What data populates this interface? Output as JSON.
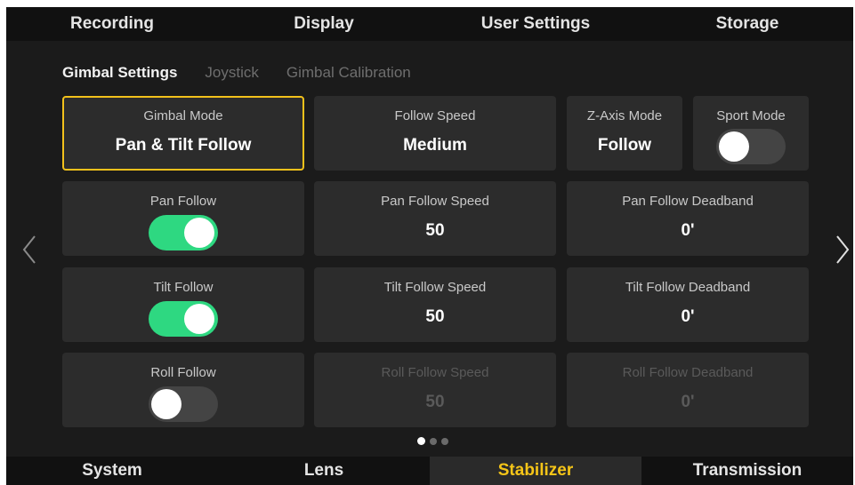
{
  "top_tabs": [
    "Recording",
    "Display",
    "User Settings",
    "Storage"
  ],
  "sub_tabs": [
    {
      "label": "Gimbal Settings",
      "active": true
    },
    {
      "label": "Joystick",
      "active": false
    },
    {
      "label": "Gimbal Calibration",
      "active": false
    }
  ],
  "gimbal_mode": {
    "label": "Gimbal Mode",
    "value": "Pan & Tilt Follow"
  },
  "follow_speed": {
    "label": "Follow Speed",
    "value": "Medium"
  },
  "z_axis_mode": {
    "label": "Z-Axis Mode",
    "value": "Follow"
  },
  "sport_mode": {
    "label": "Sport Mode",
    "state": "off"
  },
  "pan_follow": {
    "label": "Pan Follow",
    "state": "on"
  },
  "pan_follow_speed": {
    "label": "Pan Follow Speed",
    "value": "50"
  },
  "pan_follow_deadband": {
    "label": "Pan Follow Deadband",
    "value": "0'"
  },
  "tilt_follow": {
    "label": "Tilt Follow",
    "state": "on"
  },
  "tilt_follow_speed": {
    "label": "Tilt Follow Speed",
    "value": "50"
  },
  "tilt_follow_deadband": {
    "label": "Tilt Follow Deadband",
    "value": "0'"
  },
  "roll_follow": {
    "label": "Roll Follow",
    "state": "off"
  },
  "roll_follow_speed": {
    "label": "Roll Follow Speed",
    "value": "50"
  },
  "roll_follow_deadband": {
    "label": "Roll Follow Deadband",
    "value": "0'"
  },
  "pagination": {
    "pages": 3,
    "current": 1
  },
  "bottom_tabs": [
    "System",
    "Lens",
    "Stabilizer",
    "Transmission"
  ],
  "bottom_active": "Stabilizer",
  "colors": {
    "accent": "#f5c518",
    "toggle_on": "#2ed881",
    "selected_border": "#f2c11b"
  }
}
